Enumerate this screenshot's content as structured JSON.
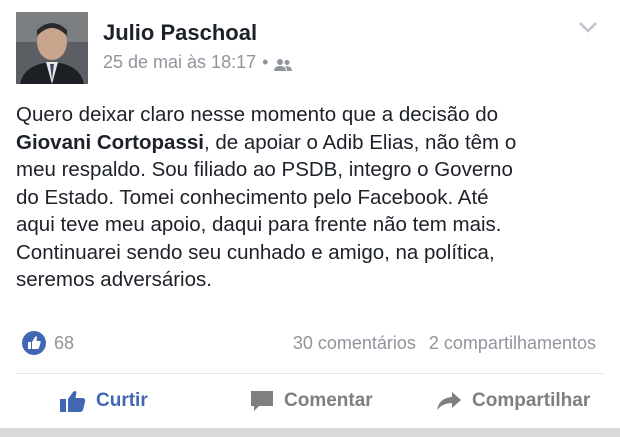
{
  "post": {
    "author": "Julio Paschoal",
    "timestamp": "25 de mai às 18:17",
    "separator": "•",
    "audience_icon": "friends-icon",
    "menu_icon": "chevron-down-icon",
    "text_lines": [
      {
        "plain": "Quero deixar claro nesse momento que a decisão do"
      },
      {
        "bold": "Giovani Cortopassi",
        "after": ", de apoiar o Adib Elias, não têm o"
      },
      {
        "plain": "meu respaldo. Sou filiado ao PSDB, integro o Governo"
      },
      {
        "plain": "do Estado. Tomei conhecimento pelo Facebook. Até"
      },
      {
        "plain": "aqui teve meu apoio, daqui para frente não tem mais."
      },
      {
        "plain": "Continuarei sendo seu cunhado e amigo, na política,"
      },
      {
        "plain": "seremos adversários."
      }
    ]
  },
  "stats": {
    "likes": "68",
    "comments": "30 comentários",
    "shares": "2 compartilhamentos"
  },
  "actions": {
    "like_label": "Curtir",
    "comment_label": "Comentar",
    "share_label": "Compartilhar"
  },
  "colors": {
    "brand_blue": "#4267b2",
    "muted_text": "#90949c",
    "action_gray": "#7f7f7f"
  }
}
